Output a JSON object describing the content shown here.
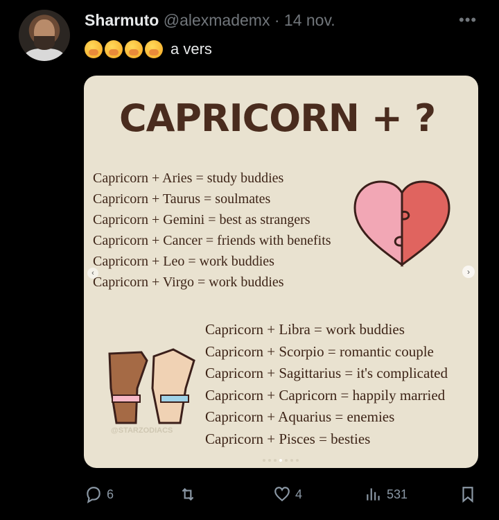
{
  "author": {
    "name": "Sharmuto",
    "handle": "@alexmademx",
    "separator": "·",
    "date": "14 nov."
  },
  "more_label": "•••",
  "tweet": {
    "emojis": [
      "face-with-hand-over-mouth",
      "face-with-hand-over-mouth",
      "face-with-hand-over-mouth",
      "face-with-hand-over-mouth"
    ],
    "text": "a vers"
  },
  "image": {
    "title": "CAPRICORN + ?",
    "matches_top": [
      "Capricorn + Aries = study buddies",
      "Capricorn + Taurus = soulmates",
      "Capricorn + Gemini = best as strangers",
      "Capricorn + Cancer = friends with benefits",
      "Capricorn + Leo = work buddies",
      "Capricorn + Virgo = work buddies"
    ],
    "matches_bottom": [
      "Capricorn + Libra = work buddies",
      "Capricorn + Scorpio = romantic couple",
      "Capricorn + Sagittarius = it's complicated",
      "Capricorn + Capricorn = happily married",
      "Capricorn + Aquarius = enemies",
      "Capricorn + Pisces = besties"
    ],
    "watermark": "@STARZODIACS",
    "nav_prev": "‹",
    "nav_next": "›"
  },
  "actions": {
    "replies": "6",
    "retweets": "",
    "likes": "4",
    "views": "531"
  },
  "colors": {
    "background": "#000000",
    "card": "#e9e2d0",
    "title": "#4a2c1e",
    "heart_left": "#f2a7b5",
    "heart_right": "#e0645f",
    "muted": "#71767b"
  }
}
